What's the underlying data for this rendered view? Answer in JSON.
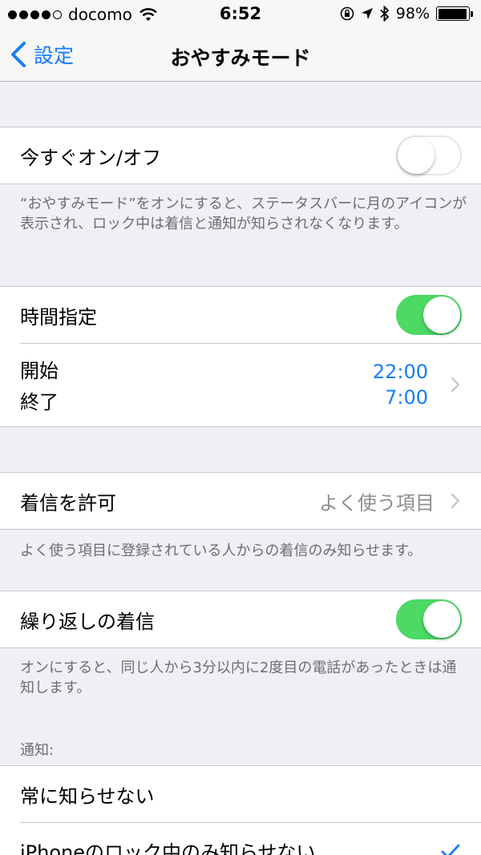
{
  "status": {
    "carrier": "docomo",
    "time": "6:52",
    "battery": "98%",
    "battery_level": 0.98
  },
  "nav": {
    "back_label": "設定",
    "title": "おやすみモード"
  },
  "manual": {
    "label": "今すぐオン/オフ",
    "enabled": false,
    "footer": "“おやすみモード”をオンにすると、ステータスバーに月のアイコンが表示され、ロック中は着信と通知が知らされなくなります。"
  },
  "schedule": {
    "label": "時間指定",
    "enabled": true,
    "start_label": "開始",
    "start_time": "22:00",
    "end_label": "終了",
    "end_time": "7:00"
  },
  "allow_calls": {
    "label": "着信を許可",
    "value": "よく使う項目",
    "footer": "よく使う項目に登録されている人からの着信のみ知らせます。"
  },
  "repeated_calls": {
    "label": "繰り返しの着信",
    "enabled": true,
    "footer": "オンにすると、同じ人から3分以内に2度目の電話があったときは通知します。"
  },
  "silence": {
    "header": "通知:",
    "option_always": "常に知らせない",
    "option_locked": "iPhoneのロック中のみ知らせない"
  },
  "colors": {
    "accent": "#157efb",
    "switch_on": "#4cd964",
    "background": "#efeff4"
  }
}
